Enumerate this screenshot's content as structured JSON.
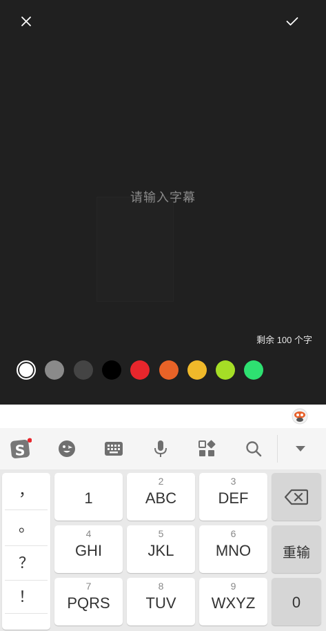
{
  "editor": {
    "placeholder": "请输入字幕",
    "remaining_text": "剩余 100 个字",
    "colors": [
      "#ffffff",
      "#8a8a8a",
      "#444444",
      "#000000",
      "#e8262c",
      "#e86327",
      "#f0b92a",
      "#a5de26",
      "#2ee071"
    ],
    "selected_color_index": 0,
    "close_icon": "close-icon",
    "confirm_icon": "check-icon"
  },
  "keyboard": {
    "toolbar_icons": [
      "sogou-logo-icon",
      "emoji-icon",
      "keyboard-icon",
      "microphone-icon",
      "apps-grid-icon",
      "search-icon",
      "collapse-arrow-icon"
    ],
    "punctuation": [
      "，",
      "。",
      "？",
      "！"
    ],
    "keys": [
      {
        "num": "",
        "label": "1"
      },
      {
        "num": "2",
        "label": "ABC"
      },
      {
        "num": "3",
        "label": "DEF"
      },
      {
        "num": "4",
        "label": "GHI"
      },
      {
        "num": "5",
        "label": "JKL"
      },
      {
        "num": "6",
        "label": "MNO"
      },
      {
        "num": "7",
        "label": "PQRS"
      },
      {
        "num": "8",
        "label": "TUV"
      },
      {
        "num": "9",
        "label": "WXYZ"
      }
    ],
    "backspace_icon": "backspace-icon",
    "reenter_label": "重输",
    "zero_label": "0"
  }
}
